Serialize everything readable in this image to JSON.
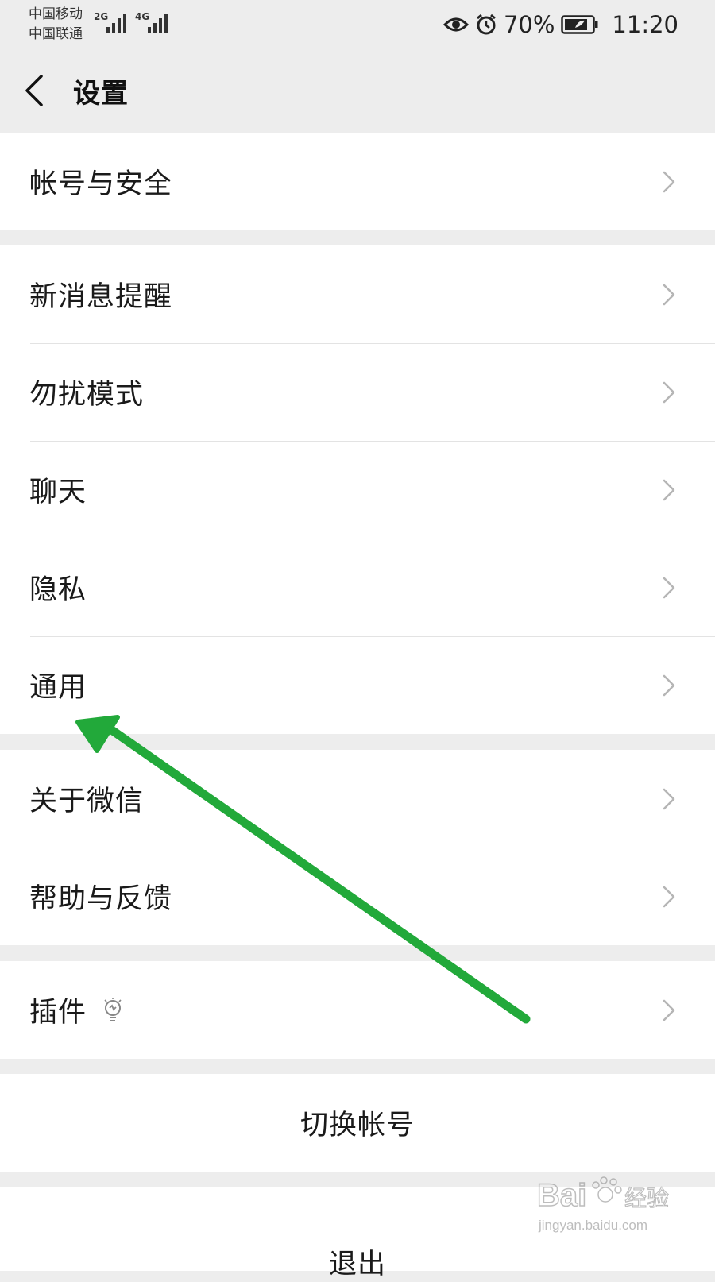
{
  "status_bar": {
    "carrier_1": "中国移动",
    "carrier_2": "中国联通",
    "network_1": "2G",
    "network_2": "4G",
    "battery_percent": "70%",
    "time": "11:20",
    "icons": [
      "eye-icon",
      "alarm-icon",
      "battery-icon",
      "signal-icon"
    ]
  },
  "header": {
    "title": "设置",
    "back_icon": "chevron-left-icon"
  },
  "groups": [
    {
      "items": [
        {
          "label": "帐号与安全"
        }
      ]
    },
    {
      "items": [
        {
          "label": "新消息提醒"
        },
        {
          "label": "勿扰模式"
        },
        {
          "label": "聊天"
        },
        {
          "label": "隐私"
        },
        {
          "label": "通用"
        }
      ]
    },
    {
      "items": [
        {
          "label": "关于微信"
        },
        {
          "label": "帮助与反馈"
        }
      ]
    },
    {
      "items": [
        {
          "label": "插件",
          "icon": "lightbulb-icon"
        }
      ]
    }
  ],
  "actions": {
    "switch_account": "切换帐号",
    "logout": "退出"
  },
  "watermark": {
    "brand": "Bai",
    "brand_cn": "经验",
    "url": "jingyan.baidu.com"
  },
  "annotation": {
    "arrow_color": "#22a93a",
    "icon": "green-arrow-icon"
  },
  "colors": {
    "background": "#ededed",
    "surface": "#ffffff",
    "divider": "#e3e3e3",
    "chevron": "#b5b5b5"
  }
}
